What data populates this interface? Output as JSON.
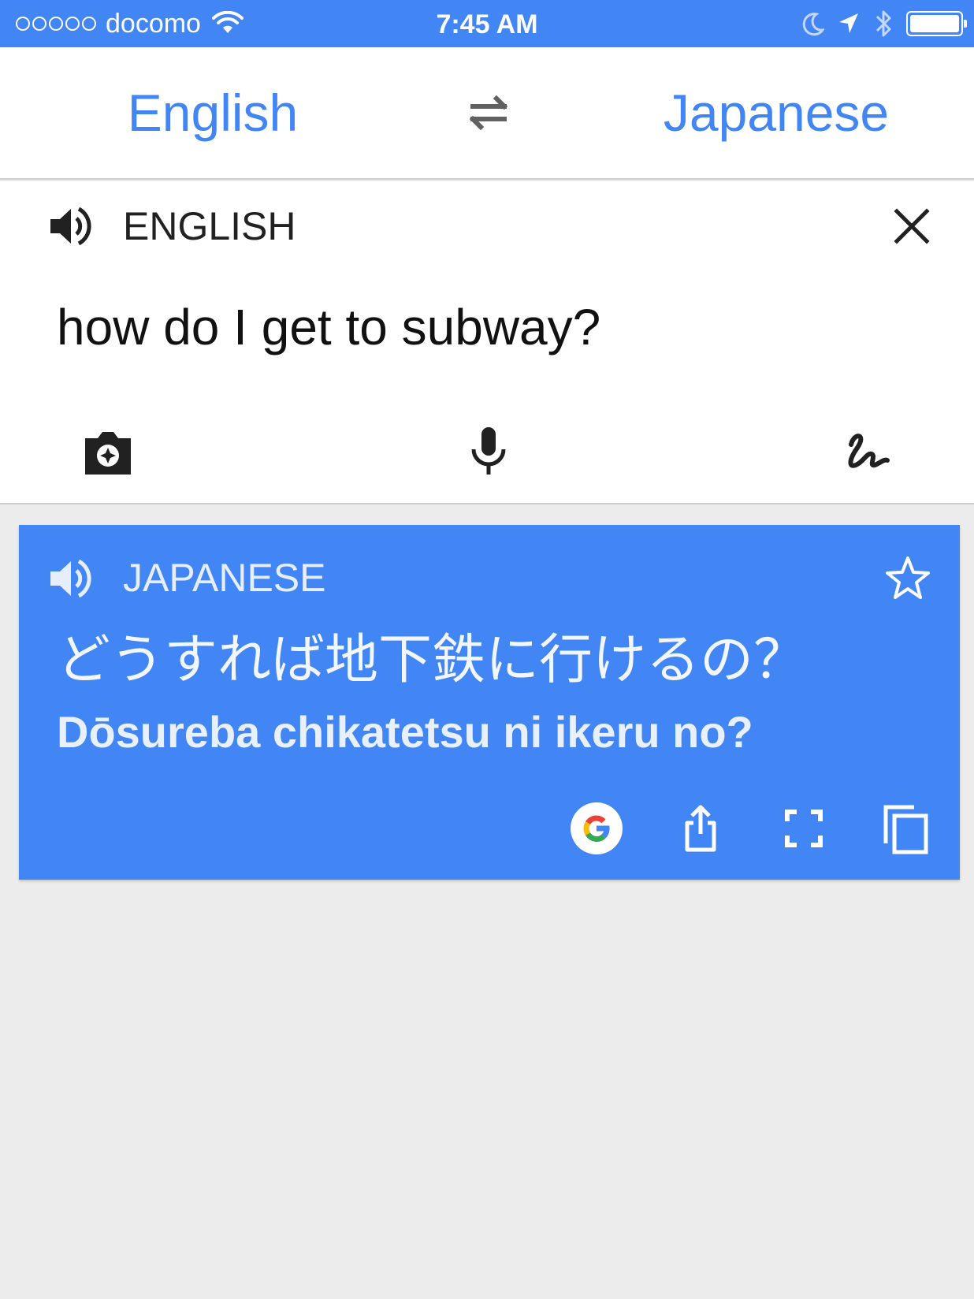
{
  "status_bar": {
    "carrier": "docomo",
    "time": "7:45 AM",
    "battery_level": 1.0
  },
  "language_bar": {
    "source_language": "English",
    "target_language": "Japanese",
    "swap_icon": "swap-arrows-icon"
  },
  "input": {
    "language_label": "ENGLISH",
    "text": "how do I get to subway?",
    "tools": {
      "camera_icon": "camera-icon",
      "mic_icon": "microphone-icon",
      "handwrite_icon": "handwriting-icon"
    }
  },
  "result": {
    "language_label": "JAPANESE",
    "translation": "どうすれば地下鉄に行けるの？",
    "romanization": "Dōsureba chikatetsu ni ikeru no?",
    "actions": [
      "google-search-icon",
      "share-icon",
      "fullscreen-icon",
      "copy-icon"
    ]
  },
  "colors": {
    "accent": "#4285f4",
    "background": "#ececec",
    "card": "#ffffff"
  }
}
